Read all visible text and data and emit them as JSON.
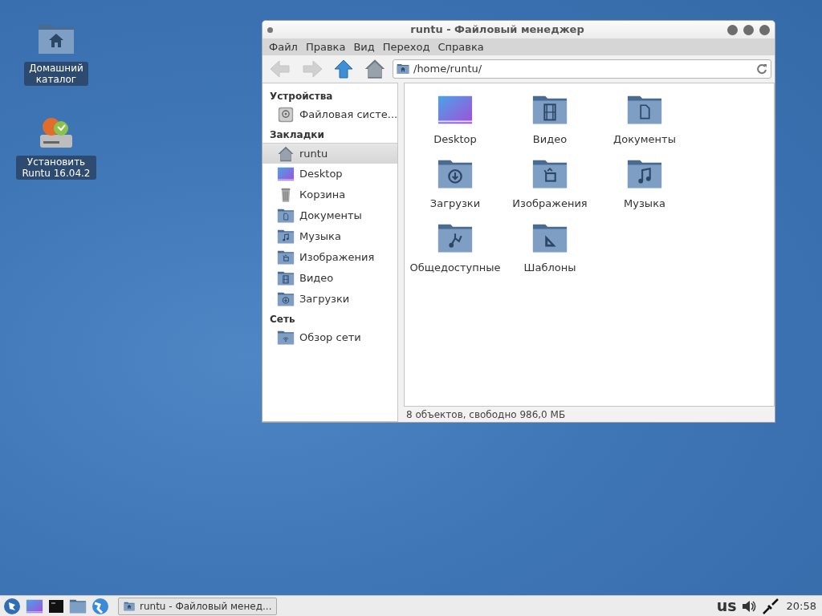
{
  "desktop_icons": [
    {
      "label": "Домашний каталог",
      "kind": "home"
    },
    {
      "label": "Установить Runtu 16.04.2",
      "kind": "installer"
    }
  ],
  "window": {
    "title": "runtu - Файловый менеджер",
    "menu": [
      "Файл",
      "Правка",
      "Вид",
      "Переход",
      "Справка"
    ],
    "toolbar": {
      "back_disabled": true,
      "forward_disabled": true
    },
    "address": "/home/runtu/",
    "sidebar": [
      {
        "title": "Устройства",
        "items": [
          {
            "label": "Файловая систе...",
            "kind": "drive",
            "selected": false
          }
        ]
      },
      {
        "title": "Закладки",
        "items": [
          {
            "label": "runtu",
            "kind": "house",
            "selected": true
          },
          {
            "label": "Desktop",
            "kind": "desktop",
            "selected": false
          },
          {
            "label": "Корзина",
            "kind": "trash",
            "selected": false
          },
          {
            "label": "Документы",
            "kind": "document",
            "selected": false
          },
          {
            "label": "Музыка",
            "kind": "music",
            "selected": false
          },
          {
            "label": "Изображения",
            "kind": "image",
            "selected": false
          },
          {
            "label": "Видео",
            "kind": "video",
            "selected": false
          },
          {
            "label": "Загрузки",
            "kind": "download",
            "selected": false
          }
        ]
      },
      {
        "title": "Сеть",
        "items": [
          {
            "label": "Обзор сети",
            "kind": "network",
            "selected": false
          }
        ]
      }
    ],
    "files": [
      {
        "label": "Desktop",
        "kind": "desktop"
      },
      {
        "label": "Видео",
        "kind": "video"
      },
      {
        "label": "Документы",
        "kind": "document"
      },
      {
        "label": "Загрузки",
        "kind": "download"
      },
      {
        "label": "Изображения",
        "kind": "image"
      },
      {
        "label": "Музыка",
        "kind": "music"
      },
      {
        "label": "Общедоступные",
        "kind": "share"
      },
      {
        "label": "Шаблоны",
        "kind": "template"
      }
    ],
    "status": "8 объектов, свободно 986,0 МБ"
  },
  "taskbar": {
    "task": "runtu - Файловый менед...",
    "task_selected": false,
    "keyboard": "us",
    "clock": "20:58"
  }
}
